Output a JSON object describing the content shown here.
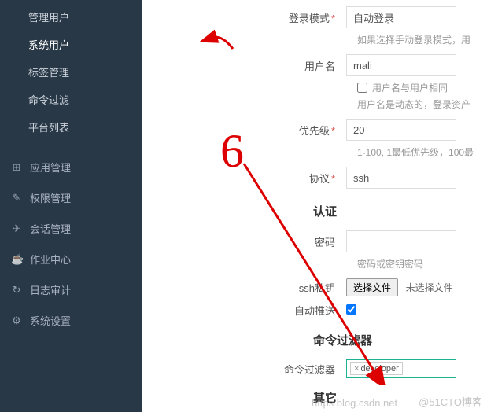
{
  "sidebar": {
    "sub_items": [
      {
        "label": "管理用户",
        "active": false
      },
      {
        "label": "系统用户",
        "active": true
      },
      {
        "label": "标签管理",
        "active": false
      },
      {
        "label": "命令过滤",
        "active": false
      },
      {
        "label": "平台列表",
        "active": false
      }
    ],
    "top_items": [
      {
        "icon": "⊞",
        "label": "应用管理"
      },
      {
        "icon": "✎",
        "label": "权限管理"
      },
      {
        "icon": "✈",
        "label": "会话管理"
      },
      {
        "icon": "☕",
        "label": "作业中心"
      },
      {
        "icon": "↻",
        "label": "日志审计"
      },
      {
        "icon": "⚙",
        "label": "系统设置"
      }
    ]
  },
  "form": {
    "login_mode": {
      "label": "登录模式",
      "value": "自动登录",
      "help": "如果选择手动登录模式，用"
    },
    "username": {
      "label": "用户名",
      "value": "mali"
    },
    "same_as_user": {
      "label": "用户名与用户相同",
      "help": "用户名是动态的，登录资产"
    },
    "priority": {
      "label": "优先级",
      "value": "20",
      "help": "1-100, 1最低优先级，100最"
    },
    "protocol": {
      "label": "协议",
      "value": "ssh"
    },
    "auth_section": "认证",
    "password": {
      "label": "密码",
      "value": "",
      "help": "密码或密钥密码"
    },
    "ssh_key": {
      "label": "ssh私钥",
      "button": "选择文件",
      "status": "未选择文件"
    },
    "auto_push": {
      "label": "自动推送",
      "checked": true
    },
    "filter_section": "命令过滤器",
    "cmd_filter": {
      "label": "命令过滤器",
      "tag": "developer"
    },
    "other_section": "其它"
  },
  "annotation": {
    "number": "6"
  },
  "watermarks": {
    "w1": "https blog.csdn.net",
    "w2": "@51CTO博客"
  }
}
